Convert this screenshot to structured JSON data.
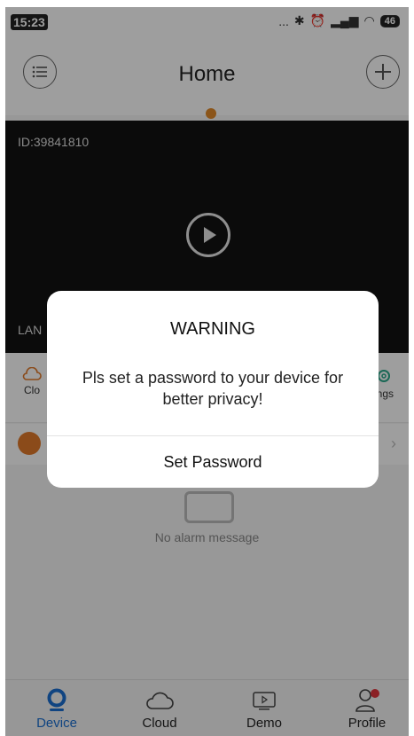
{
  "status_bar": {
    "time": "15:23",
    "dots": "...",
    "battery": "46"
  },
  "header": {
    "title": "Home"
  },
  "video": {
    "device_id": "ID:39841810",
    "connection": "LAN"
  },
  "features": {
    "left_label": "Clo",
    "right_label": "ings"
  },
  "alarm": {
    "empty_text": "No alarm message"
  },
  "tabs": [
    {
      "label": "Device"
    },
    {
      "label": "Cloud"
    },
    {
      "label": "Demo"
    },
    {
      "label": "Profile"
    }
  ],
  "dialog": {
    "title": "WARNING",
    "message": "Pls set a password to your device for better privacy!",
    "button_label": "Set Password"
  },
  "colors": {
    "accent_blue": "#1a6fd0",
    "orange": "#e08a2a",
    "notification_red": "#e0343c"
  }
}
